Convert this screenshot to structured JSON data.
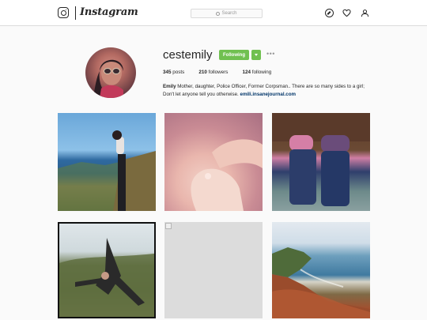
{
  "header": {
    "wordmark": "Instagram",
    "search_placeholder": "Search",
    "nav_icons": [
      "compass-icon",
      "heart-icon",
      "person-icon"
    ]
  },
  "profile": {
    "username": "cestemily",
    "follow_label": "Following",
    "more_label": "•••",
    "stats": {
      "posts_count": "345",
      "posts_label": "posts",
      "followers_count": "210",
      "followers_label": "followers",
      "following_count": "124",
      "following_label": "following"
    },
    "bio": {
      "name": "Emily",
      "text": " Mother, daughter, Police Officer, Former Corpsman.. There are so many sides to a girl; Don't let anyone tell you otherwise. ",
      "link": "emili.insanejournal.com"
    }
  },
  "colors": {
    "follow_green": "#70c050",
    "link_blue": "#003569",
    "border": "#dbdbdb"
  }
}
